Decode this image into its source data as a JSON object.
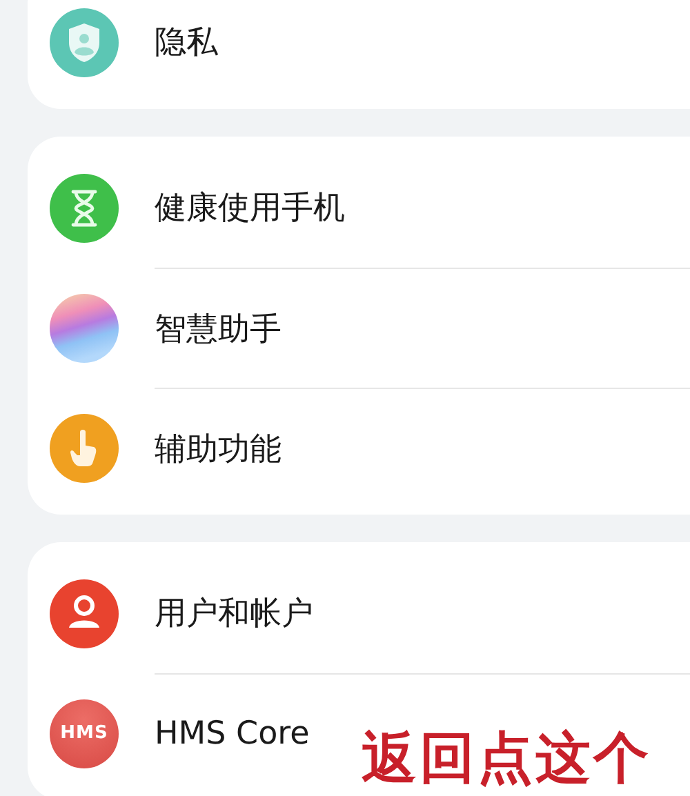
{
  "sections": [
    {
      "items": [
        {
          "label": "隐私"
        }
      ]
    },
    {
      "items": [
        {
          "label": "健康使用手机"
        },
        {
          "label": "智慧助手"
        },
        {
          "label": "辅助功能"
        }
      ]
    },
    {
      "items": [
        {
          "label": "用户和帐户"
        },
        {
          "icon_text": "HMS",
          "label": "HMS Core"
        }
      ]
    }
  ],
  "annotation": "返回点这个"
}
